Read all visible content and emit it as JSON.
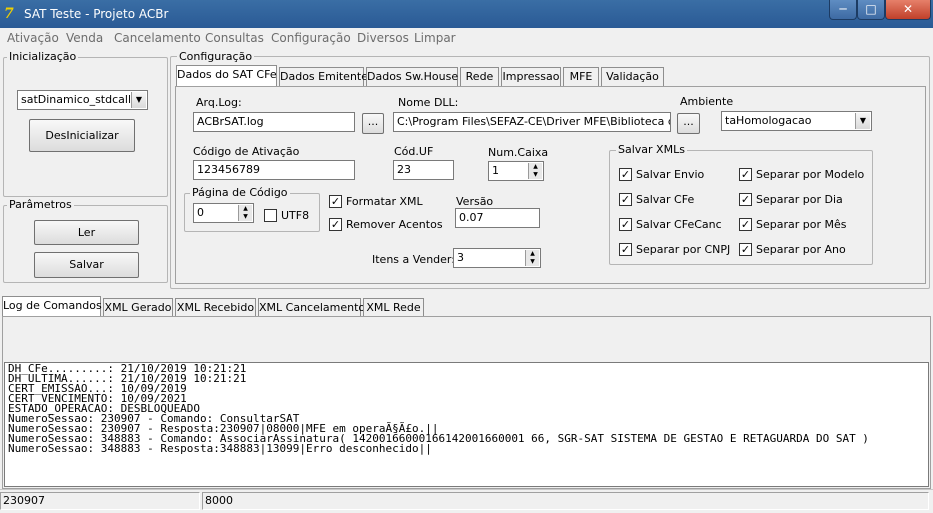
{
  "window": {
    "title": "SAT Teste - Projeto ACBr",
    "icon_text": "7"
  },
  "menu": [
    "Ativação",
    "Venda",
    "Cancelamento",
    "Consultas",
    "Configuração",
    "Diversos",
    "Limpar"
  ],
  "inicializacao": {
    "legend": "Inicialização",
    "lib_select": "satDinamico_stdcall",
    "desinicializar_label": "DesInicializar"
  },
  "parametros": {
    "legend": "Parâmetros",
    "ler_label": "Ler",
    "salvar_label": "Salvar"
  },
  "config": {
    "legend": "Configuração",
    "tabs": [
      "Dados do SAT CFe",
      "Dados Emitente",
      "Dados Sw.House",
      "Rede",
      "Impressao",
      "MFE",
      "Validação"
    ],
    "arq_log_label": "Arq.Log:",
    "arq_log_value": "ACBrSAT.log",
    "browse_label": "...",
    "nome_dll_label": "Nome DLL:",
    "nome_dll_value": "C:\\Program Files\\SEFAZ-CE\\Driver MFE\\Biblioteca de funções",
    "ambiente_label": "Ambiente",
    "ambiente_value": "taHomologacao",
    "codigo_ativacao_label": "Código de Ativação",
    "codigo_ativacao_value": "123456789",
    "cod_uf_label": "Cód.UF",
    "cod_uf_value": "23",
    "num_caixa_label": "Num.Caixa",
    "num_caixa_value": "1",
    "pagina_codigo_legend": "Página de Código",
    "pagina_codigo_value": "0",
    "utf8_label": "UTF8",
    "formatar_xml_label": "Formatar XML",
    "remover_acentos_label": "Remover Acentos",
    "versao_label": "Versão",
    "versao_value": "0.07",
    "itens_vender_label": "Itens a Vender:",
    "itens_vender_value": "3",
    "salvar_xmls": {
      "legend": "Salvar XMLs",
      "items": [
        "Salvar Envio",
        "Salvar CFe",
        "Salvar CFeCanc",
        "Separar por CNPJ",
        "Separar por Modelo",
        "Separar por Dia",
        "Separar por Mês",
        "Separar por Ano"
      ]
    }
  },
  "log_tabs": [
    "Log de Comandos",
    "XML Gerado",
    "XML Recebido",
    "XML Cancelamento",
    "XML Rede"
  ],
  "log_lines": [
    "DH_CFe.........: 21/10/2019 10:21:21",
    "DH_ULTIMA......: 21/10/2019 10:21:21",
    "CERT_EMISSAO...: 10/09/2019",
    "CERT_VENCIMENTO: 10/09/2021",
    "ESTADO_OPERACAO: DESBLOQUEADO",
    "NumeroSessao: 230907 - Comando: ConsultarSAT",
    "NumeroSessao: 230907 - Resposta:230907|08000|MFE em operaÃ§Ã£o.||",
    "NumeroSessao: 348883 - Comando: AssociarAssinatura( 14200166000166142001660001 66, SGR-SAT SISTEMA DE GESTAO E RETAGUARDA DO SAT )",
    "NumeroSessao: 348883 - Resposta:348883|13099|Erro desconhecido||"
  ],
  "status": {
    "session": "230907",
    "code": "8000"
  }
}
